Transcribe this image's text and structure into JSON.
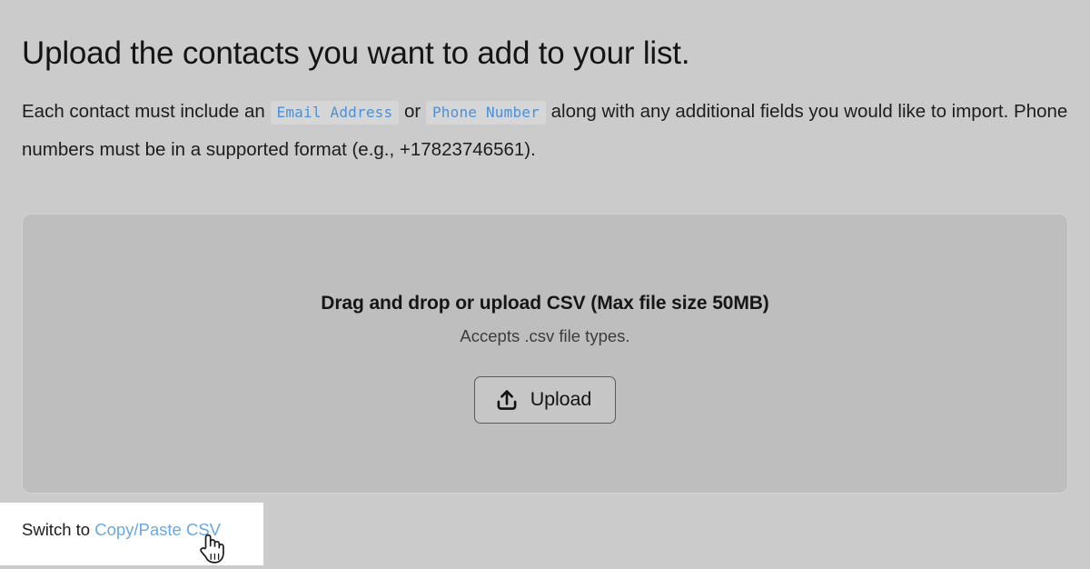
{
  "page": {
    "background_color": "#cbcbcb",
    "title": "Upload the contacts you want to add to your list.",
    "intro": {
      "part1": "Each contact must include an ",
      "chip1": "Email Address",
      "part2": " or ",
      "chip2": "Phone Number",
      "part3": " along with any additional fields you would like to import. Phone numbers must be in a supported format (e.g., +17823746561)."
    }
  },
  "dropzone": {
    "title": "Drag and drop or upload CSV (Max file size 50MB)",
    "subtitle": "Accepts .csv file types.",
    "upload_button": {
      "label": "Upload",
      "icon": "upload-icon"
    }
  },
  "footer": {
    "switch_prefix": "Switch to ",
    "switch_link": "Copy/Paste CSV",
    "link_color": "#6aa9e0",
    "cursor": "pointer-hand-cursor"
  }
}
